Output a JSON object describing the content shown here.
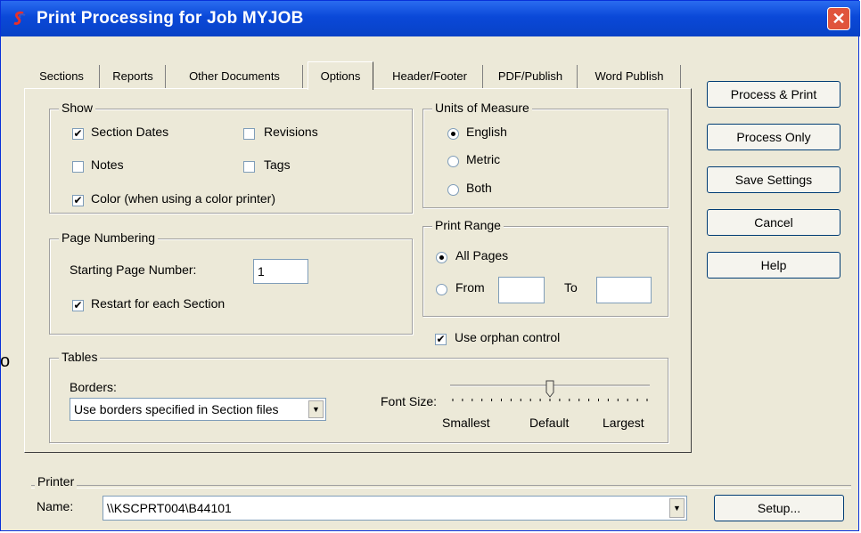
{
  "window": {
    "title": "Print Processing for Job MYJOB",
    "close_glyph": "✕",
    "app_icon": "app-s-icon"
  },
  "tabs": [
    {
      "label": "Sections"
    },
    {
      "label": "Reports"
    },
    {
      "label": "Other Documents"
    },
    {
      "label": "Options",
      "active": true
    },
    {
      "label": "Header/Footer"
    },
    {
      "label": "PDF/Publish"
    },
    {
      "label": "Word Publish"
    }
  ],
  "show": {
    "title": "Show",
    "section_dates": {
      "label": "Section Dates",
      "checked": true
    },
    "revisions": {
      "label": "Revisions",
      "checked": false
    },
    "notes": {
      "label": "Notes",
      "checked": false
    },
    "tags": {
      "label": "Tags",
      "checked": false
    },
    "color": {
      "label": "Color (when using a color printer)",
      "checked": true
    }
  },
  "units": {
    "title": "Units of Measure",
    "options": [
      {
        "label": "English",
        "selected": true
      },
      {
        "label": "Metric",
        "selected": false
      },
      {
        "label": "Both",
        "selected": false
      }
    ]
  },
  "page_numbering": {
    "title": "Page Numbering",
    "starting_label": "Starting Page Number:",
    "starting_value": "1",
    "restart": {
      "label": "Restart for each Section",
      "checked": true
    }
  },
  "print_range": {
    "title": "Print Range",
    "all_pages": {
      "label": "All Pages",
      "selected": true
    },
    "from": {
      "label": "From",
      "selected": false,
      "value": ""
    },
    "to": {
      "label": "To",
      "value": ""
    }
  },
  "orphan": {
    "label": "Use orphan control",
    "checked": true
  },
  "tables": {
    "title": "Tables",
    "borders_label": "Borders:",
    "borders_value": "Use borders specified in Section files",
    "font_size_label": "Font Size:",
    "slider_labels": [
      "Smallest",
      "Default",
      "Largest"
    ],
    "slider_value": 0.5
  },
  "buttons": {
    "process_print": "Process & Print",
    "process_only": "Process Only",
    "save_settings": "Save Settings",
    "cancel": "Cancel",
    "help": "Help",
    "setup": "Setup..."
  },
  "printer": {
    "title": "Printer",
    "name_label": "Name:",
    "name_value": "\\\\KSCPRT004\\B44101"
  },
  "check_glyph": "✔",
  "dropdown_glyph": "▼",
  "edge_char": "o"
}
